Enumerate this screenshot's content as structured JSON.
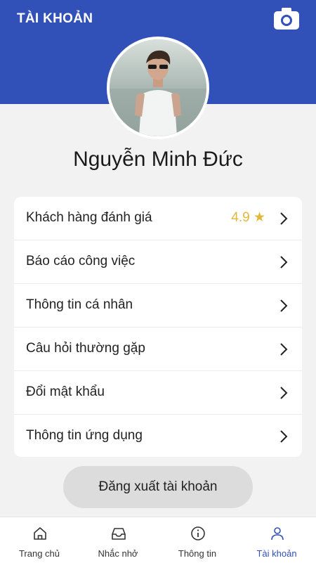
{
  "header": {
    "title": "TÀI KHOẢN",
    "camera_icon": "camera-icon",
    "background": "#3150b8"
  },
  "profile": {
    "name": "Nguyễn Minh Đức",
    "avatar_icon": "avatar-photo"
  },
  "menu": {
    "items": [
      {
        "label": "Khách hàng đánh giá",
        "rating": "4.9 ★"
      },
      {
        "label": "Báo cáo công việc"
      },
      {
        "label": "Thông tin cá nhân"
      },
      {
        "label": "Câu hỏi thường gặp"
      },
      {
        "label": "Đổi mật khẩu"
      },
      {
        "label": "Thông tin ứng dụng"
      }
    ],
    "chevron_icon": "chevron-right-icon"
  },
  "logout": {
    "label": "Đăng xuất tài khoản"
  },
  "bottom_nav": {
    "items": [
      {
        "label": "Trang chủ",
        "icon": "home-icon"
      },
      {
        "label": "Nhắc nhở",
        "icon": "inbox-icon"
      },
      {
        "label": "Thông tin",
        "icon": "info-icon"
      },
      {
        "label": "Tài khoản",
        "icon": "user-icon",
        "active": true
      }
    ],
    "active_color": "#3150b8"
  },
  "colors": {
    "rating": "#e2b83a",
    "page_bg": "#f2f2f2"
  }
}
